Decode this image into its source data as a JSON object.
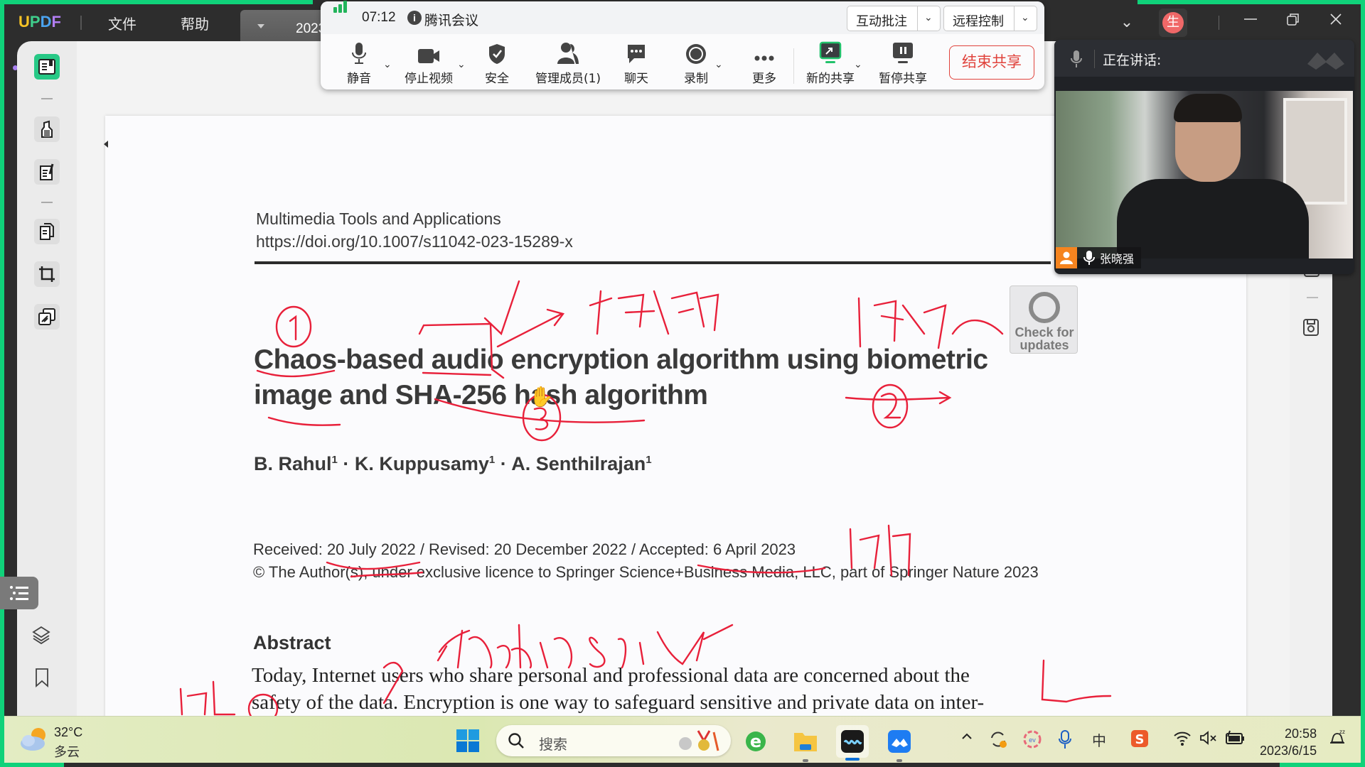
{
  "app": {
    "logo": {
      "letters": [
        "U",
        "P",
        "D",
        "F"
      ],
      "colors": [
        "#f7c325",
        "#3fce8c",
        "#4aa3ef",
        "#b27ef3"
      ]
    },
    "menu": [
      "文件",
      "帮助"
    ],
    "tab": {
      "title": "2023"
    },
    "accent": "#27c986",
    "window": {
      "avatar_char": "生",
      "avatar_color": "#f06868"
    }
  },
  "sidebar": {
    "tools": [
      {
        "name": "reader",
        "active": true
      },
      {
        "name": "highlight"
      },
      {
        "name": "edit-text"
      },
      {
        "name": "organize-pages"
      },
      {
        "name": "crop"
      },
      {
        "name": "watermark"
      }
    ],
    "bottom": [
      "outline",
      "layers",
      "bookmark"
    ]
  },
  "meeting": {
    "elapsed": "07:12",
    "app_name": "腾讯会议",
    "dropdowns": [
      "互动批注",
      "远程控制"
    ],
    "buttons": [
      "静音",
      "停止视频",
      "安全",
      "管理成员(1)",
      "聊天",
      "录制",
      "更多",
      "新的共享",
      "暂停共享"
    ],
    "end_share": "结束共享",
    "signal_color": "#22b45b",
    "end_color": "#e0433c",
    "speaker": {
      "label": "正在讲话:",
      "participant": "张晓强"
    }
  },
  "document": {
    "journal": "Multimedia Tools and Applications",
    "doi": "https://doi.org/10.1007/s11042-023-15289-x",
    "title_line1": "Chaos-based audio encryption algorithm using biometric",
    "title_line2": "image and SHA-256 hash algorithm",
    "authors": [
      {
        "name": "B. Rahul",
        "aff": "1"
      },
      {
        "name": "K. Kuppusamy",
        "aff": "1"
      },
      {
        "name": "A. Senthilrajan",
        "aff": "1"
      }
    ],
    "author_sep": " · ",
    "dates": "Received: 20 July 2022 / Revised: 20 December 2022 / Accepted: 6 April 2023",
    "copyright": "© The Author(s), under exclusive licence to Springer Science+Business Media, LLC, part of Springer Nature 2023",
    "check_updates": [
      "Check for",
      "updates"
    ],
    "abstract_heading": "Abstract",
    "abstract_line1": "Today, Internet users who share personal and professional data are concerned about the",
    "abstract_line2": "safety of the data. Encryption is one way to safeguard sensitive and private data on inter-",
    "annotations": {
      "ink_color": "#e8203a",
      "handwritten_note": "the data security",
      "date_note": "9个月",
      "circled_numbers": [
        "1",
        "2",
        "3"
      ]
    }
  },
  "taskbar": {
    "weather": {
      "temp": "32°C",
      "desc": "多云"
    },
    "search_placeholder": "搜索",
    "clock": {
      "time": "20:58",
      "date": "2023/6/15"
    },
    "tray": [
      "show-hidden",
      "sync",
      "ev-app",
      "microphone",
      "ime-zh",
      "sogou",
      "wifi",
      "volume-muted",
      "battery-charging"
    ],
    "ime": "中"
  }
}
